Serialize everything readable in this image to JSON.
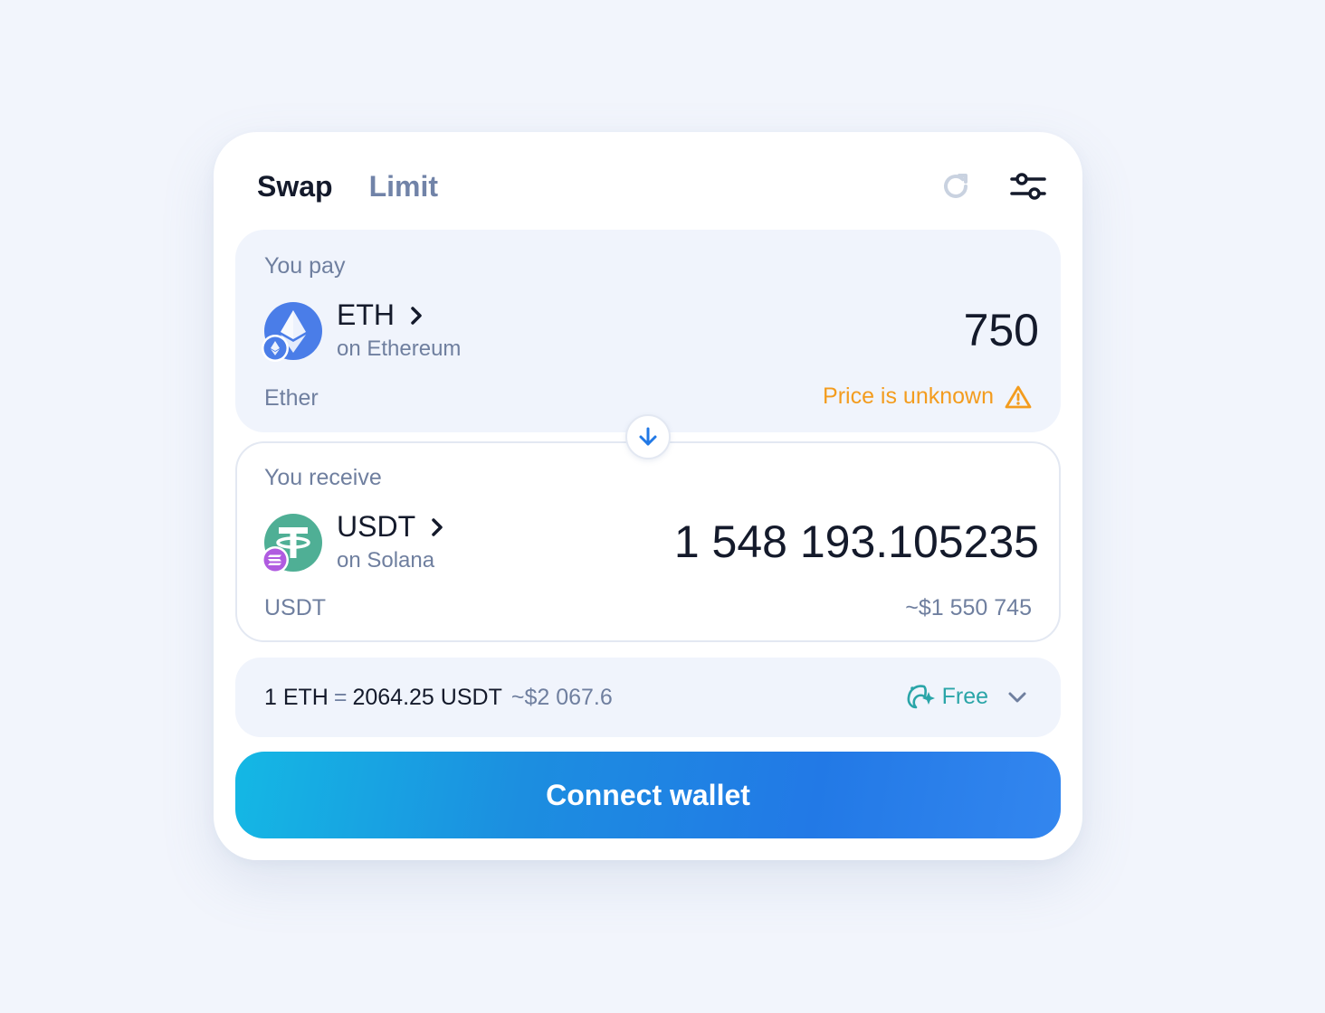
{
  "tabs": {
    "swap": "Swap",
    "limit": "Limit"
  },
  "pay": {
    "label": "You pay",
    "token_symbol": "ETH",
    "chain": "on Ethereum",
    "token_name": "Ether",
    "amount": "750",
    "price_status": "Price is unknown"
  },
  "receive": {
    "label": "You receive",
    "token_symbol": "USDT",
    "chain": "on Solana",
    "token_name": "USDT",
    "amount": "1 548 193.105235",
    "usd_value": "~$1 550 745"
  },
  "rate": {
    "base": "1 ETH",
    "eq": "=",
    "quote": "2064.25 USDT",
    "usd": "~$2 067.6",
    "fee": "Free"
  },
  "connect_button": "Connect wallet",
  "colors": {
    "accent": "#2279e6",
    "warning": "#f39c1e",
    "fee": "#2aa5a8",
    "eth": "#4a7de8",
    "usdt": "#4faf95"
  },
  "icons": {
    "refresh": "refresh-icon",
    "settings": "sliders-icon",
    "swap_direction": "arrow-down-icon",
    "warning": "warning-icon",
    "fee": "rocket-icon"
  }
}
